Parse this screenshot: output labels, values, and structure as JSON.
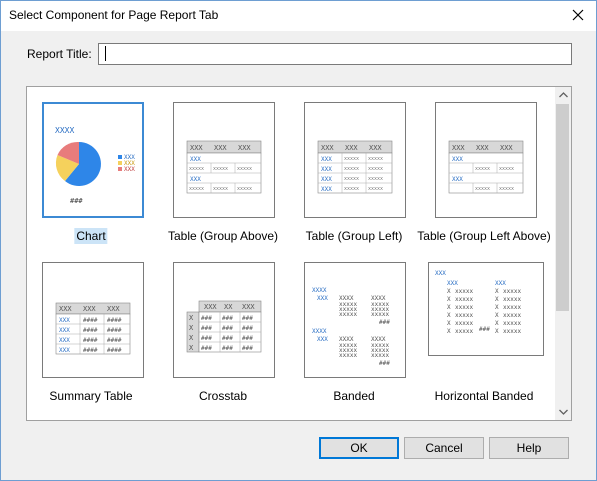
{
  "dialog": {
    "title": "Select Component for Page Report Tab"
  },
  "report_title": {
    "label": "Report Title:",
    "value": ""
  },
  "components": [
    {
      "label": "Chart",
      "selected": true
    },
    {
      "label": "Table (Group Above)",
      "selected": false
    },
    {
      "label": "Table (Group Left)",
      "selected": false
    },
    {
      "label": "Table (Group Left Above)",
      "selected": false
    },
    {
      "label": "Summary Table",
      "selected": false
    },
    {
      "label": "Crosstab",
      "selected": false
    },
    {
      "label": "Banded",
      "selected": false
    },
    {
      "label": "Horizontal Banded",
      "selected": false
    }
  ],
  "preview_text": {
    "xxx": "XXX",
    "xxxx": "XXXX",
    "hash": "###",
    "hash4": "####",
    "xx": "XX"
  },
  "buttons": {
    "ok": "OK",
    "cancel": "Cancel",
    "help": "Help"
  },
  "colors": {
    "accent": "#3c8ad4",
    "pie_blue": "#2e86e8",
    "pie_yellow": "#f5d15c",
    "pie_red": "#e87c7c",
    "table_header": "#d8d8d8",
    "xxx_blue": "#2b6fc4"
  }
}
